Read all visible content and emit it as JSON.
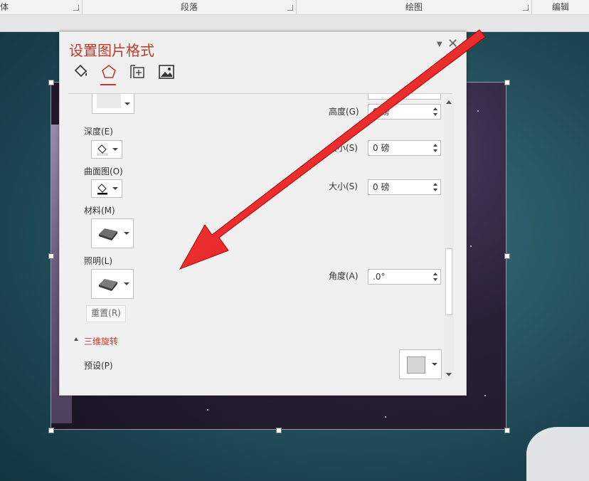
{
  "ribbon": {
    "groups": [
      "体",
      "段落",
      "绘图",
      "编辑"
    ]
  },
  "pane": {
    "title": "设置图片格式",
    "tabs": [
      "fill-line-icon",
      "effects-pentagon-icon",
      "size-properties-icon",
      "picture-icon"
    ],
    "left": {
      "depth_label": "深度(E)",
      "contour_label": "曲面图(O)",
      "material_label": "材料(M)",
      "lighting_label": "照明(L)",
      "reset_label": "重置(R)"
    },
    "right": {
      "height_label": "高度(G)",
      "height_value": "0 磅",
      "size1_label": "大小(S)",
      "size1_value": "0 磅",
      "size2_label": "大小(S)",
      "size2_value": "0 磅",
      "angle_label": "角度(A)",
      "angle_value": ".0°"
    },
    "section": {
      "title": "三维旋转",
      "preset_label": "预设(P)"
    }
  },
  "colors": {
    "accent": "#c0392b",
    "arrow": "#e01b1b",
    "slide_bg": "#2a5d69"
  }
}
